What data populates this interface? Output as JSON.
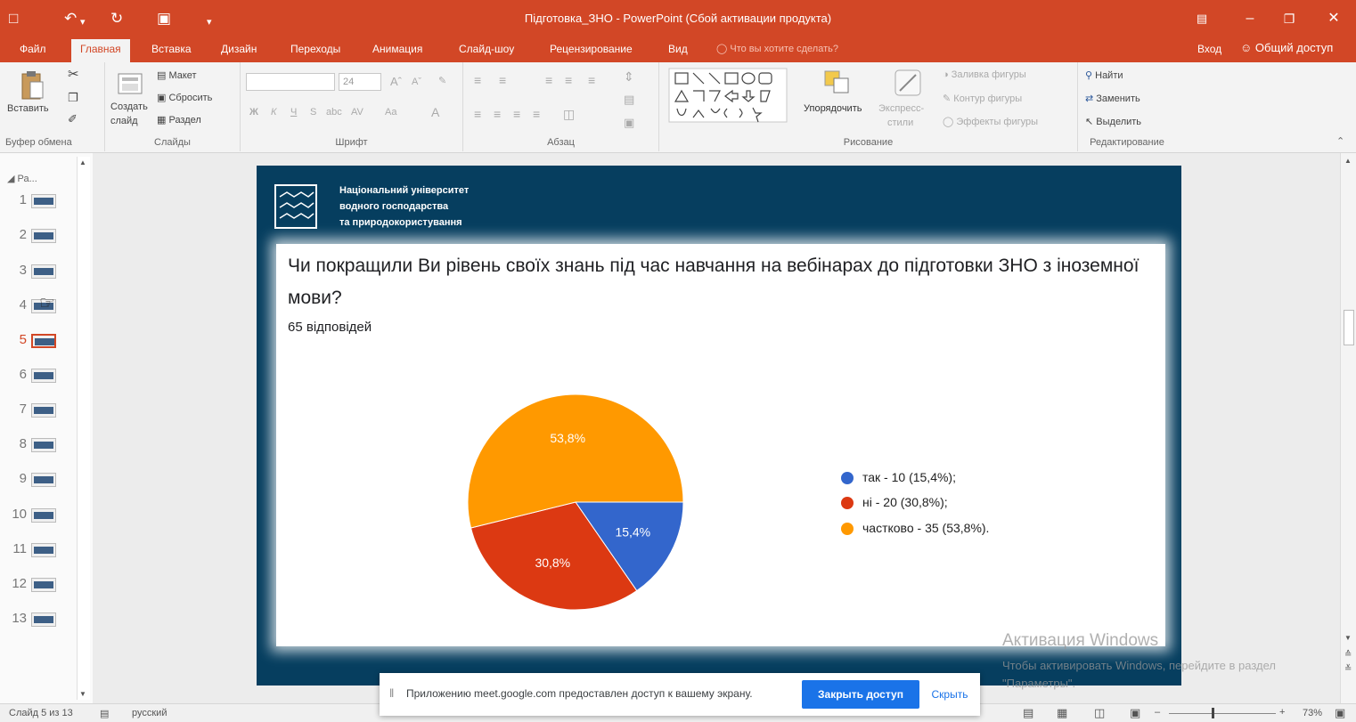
{
  "colors": {
    "accent": "#d24726",
    "slide_bg": "#063e5f",
    "pie_blue": "#3366cc",
    "pie_red": "#dc3912",
    "pie_orange": "#ff9900"
  },
  "window": {
    "title": "Підготовка_ЗНО - PowerPoint (Сбой активации продукта)",
    "quick_access_icons": [
      "save-icon",
      "undo-icon",
      "redo-icon",
      "present-icon",
      "customize-icon"
    ],
    "controls_icons": [
      "ribbon-display-icon",
      "minimize-icon",
      "restore-icon",
      "close-icon"
    ]
  },
  "ribbon_tabs": [
    "Файл",
    "Главная",
    "Вставка",
    "Дизайн",
    "Переходы",
    "Анимация",
    "Слайд-шоу",
    "Рецензирование",
    "Вид"
  ],
  "active_tab": "Главная",
  "tell_me": "Что вы хотите сделать?",
  "sign_in": "Вход",
  "share": "Общий доступ",
  "ribbon": {
    "clipboard": {
      "label": "Буфер обмена",
      "paste": "Вставить"
    },
    "slides": {
      "label": "Слайды",
      "new_slide_1": "Создать",
      "new_slide_2": "слайд",
      "layout": "Макет",
      "reset": "Сбросить",
      "section": "Раздел"
    },
    "font": {
      "label": "Шрифт",
      "size": "24"
    },
    "paragraph": {
      "label": "Абзац"
    },
    "drawing": {
      "label": "Рисование",
      "arrange": "Упорядочить",
      "quick_styles_1": "Экспресс-",
      "quick_styles_2": "стили",
      "shape_fill": "Заливка фигуры",
      "shape_outline": "Контур фигуры",
      "shape_effects": "Эффекты фигуры"
    },
    "editing": {
      "label": "Редактирование",
      "find": "Найти",
      "replace": "Заменить",
      "select": "Выделить"
    }
  },
  "thumbnails": {
    "section_label": "Ра...",
    "numbers": [
      "1",
      "2",
      "3",
      "4",
      "5",
      "6",
      "7",
      "8",
      "9",
      "10",
      "11",
      "12",
      "13"
    ],
    "selected": "5"
  },
  "slide": {
    "org_line1": "Національний університет",
    "org_line2": "водного господарства",
    "org_line3": "та природокористування",
    "question": "Чи покращили Ви рівень своїх знань під час навчання на вебінарах до підготовки ЗНО з іноземної мови?",
    "responses": "65 відповідей"
  },
  "chart_data": {
    "type": "pie",
    "title": "",
    "series": [
      {
        "label": "так - 10 (15,4%);",
        "value": 10,
        "percent_label": "15,4%",
        "color": "#3366cc"
      },
      {
        "label": "ні - 20 (30,8%);",
        "value": 20,
        "percent_label": "30,8%",
        "color": "#dc3912"
      },
      {
        "label": "частково - 35 (53,8%).",
        "value": 35,
        "percent_label": "53,8%",
        "color": "#ff9900"
      }
    ],
    "legend_position": "right"
  },
  "watermark": {
    "line1": "Активация Windows",
    "line2": "Чтобы активировать Windows, перейдите в раздел \"Параметры\"."
  },
  "notification": {
    "message": "Приложению meet.google.com предоставлен доступ к вашему экрану.",
    "stop_button": "Закрыть доступ",
    "hide_button": "Скрыть"
  },
  "status": {
    "slide_info": "Слайд 5 из 13",
    "language": "русский",
    "zoom": "73%"
  }
}
